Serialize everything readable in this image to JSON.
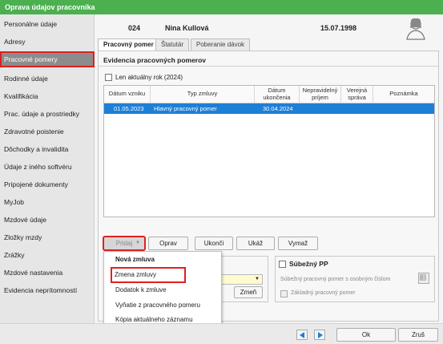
{
  "window": {
    "title": "Oprava údajov pracovníka"
  },
  "sidebar": {
    "items": [
      {
        "label": "Personálne údaje"
      },
      {
        "label": "Adresy"
      },
      {
        "label": "Pracovné pomery"
      },
      {
        "label": "Rodinné údaje"
      },
      {
        "label": "Kvalifikácia"
      },
      {
        "label": "Prac. údaje a prostriedky"
      },
      {
        "label": "Zdravotné poistenie"
      },
      {
        "label": "Dôchodky a invalidita"
      },
      {
        "label": "Údaje z iného softvéru"
      },
      {
        "label": "Pripojené dokumenty"
      },
      {
        "label": "MyJob"
      },
      {
        "label": "Mzdové údaje"
      },
      {
        "label": "Zložky mzdy"
      },
      {
        "label": "Zrážky"
      },
      {
        "label": "Mzdové nastavenia"
      },
      {
        "label": "Evidencia neprítomností"
      }
    ],
    "active_index": 2
  },
  "employee": {
    "number": "024",
    "name": "Nina Kullová",
    "birth_date": "15.07.1998"
  },
  "tabs": [
    {
      "label": "Pracovný pomer"
    },
    {
      "label": "Štatutár"
    },
    {
      "label": "Poberanie dávok"
    }
  ],
  "employment": {
    "section_title": "Evidencia pracovných pomerov",
    "filter_label": "Len aktuálny rok (2024)",
    "columns": [
      "Dátum vzniku",
      "Typ zmluvy",
      "Dátum ukončenia",
      "Nepravidelný príjem",
      "Verejná správa",
      "Poznámka"
    ],
    "rows": [
      {
        "start": "01.05.2023",
        "type": "Hlavný pracovný pomer",
        "end": "30.04.2024",
        "irregular": "",
        "public": "",
        "note": ""
      }
    ]
  },
  "actions": {
    "add": "Pridaj",
    "edit": "Oprav",
    "end": "Ukonči",
    "show": "Ukáž",
    "delete": "Vymaž"
  },
  "add_menu": {
    "items": [
      "Nová zmluva",
      "Zmena zmluvy",
      "Dodatok k zmluve",
      "Vyňatie z pracovného pomeru",
      "Kópia aktuálneho záznamu"
    ],
    "highlighted_index": 1
  },
  "lower": {
    "change_button": "Zmeň",
    "concurrent": {
      "title": "Súbežný PP",
      "field_label": "Súbežný pracovný pomer s osobným číslom",
      "base_label": "Základný pracovný pomer"
    }
  },
  "footer": {
    "ok": "Ok",
    "cancel": "Zruš"
  },
  "colors": {
    "titlebar": "#4caf50",
    "selection": "#1e7fd6",
    "highlight": "#e02020"
  }
}
